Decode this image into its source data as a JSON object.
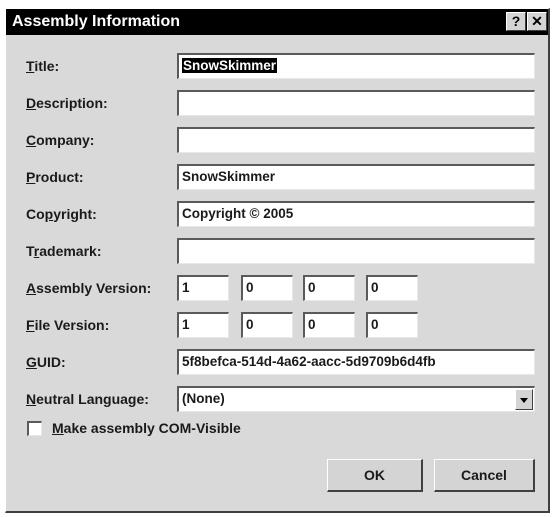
{
  "dialog": {
    "title": "Assembly Information",
    "help_glyph": "?",
    "close_glyph": "✕"
  },
  "fields": {
    "title": {
      "label": "Title:",
      "value": "SnowSkimmer"
    },
    "description": {
      "label": "Description:",
      "value": ""
    },
    "company": {
      "label": "Company:",
      "value": ""
    },
    "product": {
      "label": "Product:",
      "value": "SnowSkimmer"
    },
    "copyright": {
      "label": "Copyright:",
      "value": "Copyright © 2005"
    },
    "trademark": {
      "label": "Trademark:",
      "value": ""
    },
    "assembly_version": {
      "label": "Assembly Version:",
      "parts": [
        "1",
        "0",
        "0",
        "0"
      ]
    },
    "file_version": {
      "label": "File Version:",
      "parts": [
        "1",
        "0",
        "0",
        "0"
      ]
    },
    "guid": {
      "label": "GUID:",
      "value": "5f8befca-514d-4a62-aacc-5d9709b6d4fb"
    },
    "neutral_language": {
      "label": "Neutral Language:",
      "value": "(None)"
    }
  },
  "com_visible": {
    "label": "Make assembly COM-Visible",
    "checked": false
  },
  "buttons": {
    "ok": "OK",
    "cancel": "Cancel"
  }
}
